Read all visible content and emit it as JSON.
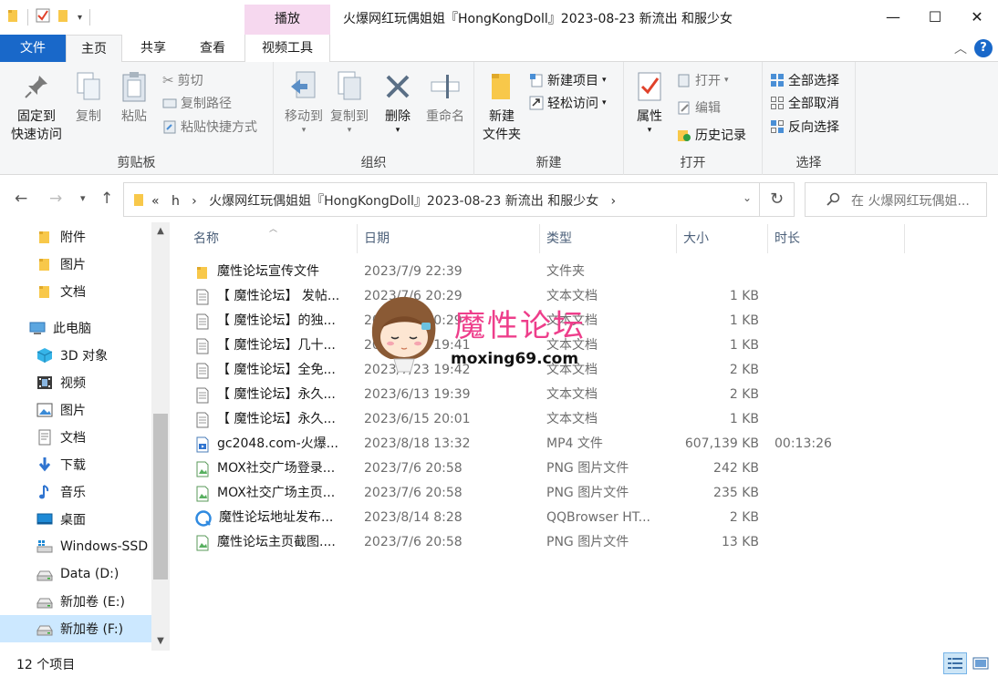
{
  "window": {
    "title": "火爆网红玩偶姐姐『HongKongDoll』2023-08-23 新流出 和服少女",
    "context_tab_group": "播放",
    "minimize_label": "—",
    "maximize_label": "☐",
    "close_label": "✕"
  },
  "ribbon_tabs": {
    "file": "文件",
    "home": "主页",
    "share": "共享",
    "view": "查看",
    "video_tools": "视频工具",
    "collapse": "︿",
    "help": "?"
  },
  "ribbon": {
    "clipboard": {
      "label": "剪贴板",
      "pin": "固定到\n快速访问",
      "copy": "复制",
      "paste": "粘贴",
      "cut": "剪切",
      "copy_path": "复制路径",
      "paste_shortcut": "粘贴快捷方式"
    },
    "organize": {
      "label": "组织",
      "move_to": "移动到",
      "copy_to": "复制到",
      "delete": "删除",
      "rename": "重命名"
    },
    "new": {
      "label": "新建",
      "new_folder": "新建\n文件夹",
      "new_item": "新建项目",
      "easy_access": "轻松访问"
    },
    "open": {
      "label": "打开",
      "properties": "属性",
      "open": "打开",
      "edit": "编辑",
      "history": "历史记录"
    },
    "select": {
      "label": "选择",
      "select_all": "全部选择",
      "select_none": "全部取消",
      "invert": "反向选择"
    }
  },
  "address": {
    "breadcrumb_prefix": "«",
    "crumb_h": "h",
    "crumb_sep": "›",
    "current": "火爆网红玩偶姐姐『HongKongDoll』2023-08-23 新流出 和服少女",
    "search_placeholder": "在 火爆网红玩偶姐..."
  },
  "nav_pane": {
    "items": [
      {
        "label": "附件",
        "icon": "folder-icon"
      },
      {
        "label": "图片",
        "icon": "folder-icon"
      },
      {
        "label": "文档",
        "icon": "folder-icon"
      },
      {
        "label": "此电脑",
        "icon": "computer-icon"
      },
      {
        "label": "3D 对象",
        "icon": "3d-objects-icon"
      },
      {
        "label": "视频",
        "icon": "video-folder-icon"
      },
      {
        "label": "图片",
        "icon": "pictures-folder-icon"
      },
      {
        "label": "文档",
        "icon": "documents-folder-icon"
      },
      {
        "label": "下载",
        "icon": "downloads-icon"
      },
      {
        "label": "音乐",
        "icon": "music-icon"
      },
      {
        "label": "桌面",
        "icon": "desktop-icon"
      },
      {
        "label": "Windows-SSD",
        "icon": "windows-drive-icon"
      },
      {
        "label": "Data (D:)",
        "icon": "drive-icon"
      },
      {
        "label": "新加卷 (E:)",
        "icon": "drive-icon"
      },
      {
        "label": "新加卷 (F:)",
        "icon": "drive-icon"
      }
    ]
  },
  "columns": {
    "name": "名称",
    "date": "日期",
    "type": "类型",
    "size": "大小",
    "duration": "时长"
  },
  "files": [
    {
      "name": "魔性论坛宣传文件",
      "date": "2023/7/9 22:39",
      "type": "文件夹",
      "size": "",
      "duration": "",
      "icon": "folder-icon"
    },
    {
      "name": "【 魔性论坛】 发帖...",
      "date": "2023/7/6 20:29",
      "type": "文本文档",
      "size": "1 KB",
      "duration": "",
      "icon": "text-file-icon"
    },
    {
      "name": "【 魔性论坛】的独...",
      "date": "2023/7/6 20:29",
      "type": "文本文档",
      "size": "1 KB",
      "duration": "",
      "icon": "text-file-icon"
    },
    {
      "name": "【 魔性论坛】几十...",
      "date": "2023/7/23 19:41",
      "type": "文本文档",
      "size": "1 KB",
      "duration": "",
      "icon": "text-file-icon"
    },
    {
      "name": "【 魔性论坛】全免...",
      "date": "2023/7/23 19:42",
      "type": "文本文档",
      "size": "2 KB",
      "duration": "",
      "icon": "text-file-icon"
    },
    {
      "name": "【 魔性论坛】永久...",
      "date": "2023/6/13 19:39",
      "type": "文本文档",
      "size": "2 KB",
      "duration": "",
      "icon": "text-file-icon"
    },
    {
      "name": "【 魔性论坛】永久...",
      "date": "2023/6/15 20:01",
      "type": "文本文档",
      "size": "1 KB",
      "duration": "",
      "icon": "text-file-icon"
    },
    {
      "name": "gc2048.com-火爆...",
      "date": "2023/8/18 13:32",
      "type": "MP4 文件",
      "size": "607,139 KB",
      "duration": "00:13:26",
      "icon": "video-file-icon"
    },
    {
      "name": "MOX社交广场登录...",
      "date": "2023/7/6 20:58",
      "type": "PNG 图片文件",
      "size": "242 KB",
      "duration": "",
      "icon": "image-file-icon"
    },
    {
      "name": "MOX社交广场主页...",
      "date": "2023/7/6 20:58",
      "type": "PNG 图片文件",
      "size": "235 KB",
      "duration": "",
      "icon": "image-file-icon"
    },
    {
      "name": "魔性论坛地址发布...",
      "date": "2023/8/14 8:28",
      "type": "QQBrowser HT...",
      "size": "2 KB",
      "duration": "",
      "icon": "browser-file-icon"
    },
    {
      "name": "魔性论坛主页截图....",
      "date": "2023/7/6 20:58",
      "type": "PNG 图片文件",
      "size": "13 KB",
      "duration": "",
      "icon": "image-file-icon"
    }
  ],
  "watermark": {
    "title": "魔性论坛",
    "url": "moxing69.com"
  },
  "status": {
    "item_count": "12 个项目"
  }
}
